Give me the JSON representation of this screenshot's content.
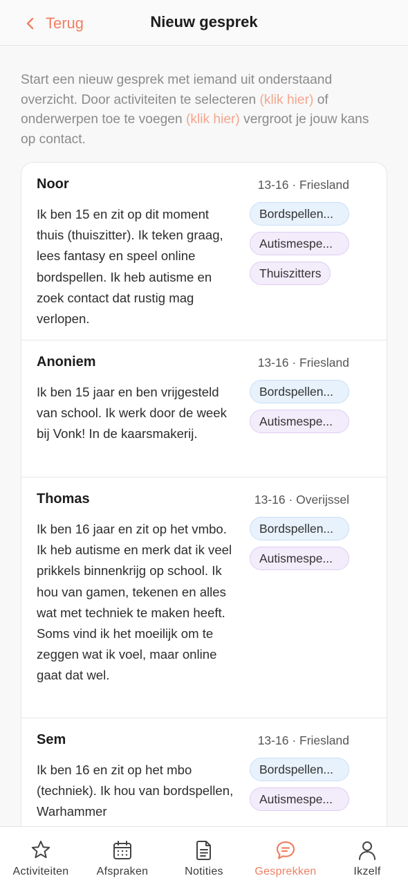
{
  "header": {
    "back_label": "Terug",
    "title": "Nieuw gesprek"
  },
  "intro": {
    "part1": "Start een nieuw gesprek met iemand uit onderstaand overzicht. Door activiteiten te selecteren ",
    "link1": "(klik hier)",
    "part2": " of onderwerpen toe te voegen ",
    "link2": "(klik hier)",
    "part3": " vergroot je jouw kans op contact."
  },
  "profiles": [
    {
      "name": "Noor",
      "meta": "13-16 · Friesland",
      "description": "Ik ben 15 en zit op dit moment thuis (thuiszitter). Ik teken graag, lees fantasy en speel online bordspellen. Ik heb autisme en zoek contact dat rustig mag verlopen.",
      "tags": [
        "Bordspellen...",
        "Autismespe...",
        "Thuiszitters"
      ]
    },
    {
      "name": "Anoniem",
      "meta": "13-16 · Friesland",
      "description": "Ik ben 15 jaar en ben vrijgesteld van school. Ik werk door de week bij Vonk! In de kaarsmakerij.",
      "tags": [
        "Bordspellen...",
        "Autismespe..."
      ]
    },
    {
      "name": "Thomas",
      "meta": "13-16 · Overijssel",
      "description": "Ik ben 16 jaar en zit op het vmbo. Ik heb autisme en merk dat ik veel prikkels binnenkrijg op school. Ik hou van gamen, tekenen en alles wat met techniek te maken heeft. Soms vind ik het moeilijk om te zeggen wat ik voel, maar online gaat dat wel.",
      "tags": [
        "Bordspellen...",
        "Autismespe..."
      ]
    },
    {
      "name": "Sem",
      "meta": "13-16 · Friesland",
      "description": "Ik ben 16 en zit op het mbo (techniek). Ik hou van bordspellen, Warhammer",
      "tags": [
        "Bordspellen...",
        "Autismespe..."
      ]
    }
  ],
  "tabbar": {
    "items": [
      {
        "label": "Activiteiten",
        "icon": "star-icon",
        "active": false
      },
      {
        "label": "Afspraken",
        "icon": "calendar-icon",
        "active": false
      },
      {
        "label": "Notities",
        "icon": "document-icon",
        "active": false
      },
      {
        "label": "Gesprekken",
        "icon": "chat-bubble-icon",
        "active": true
      },
      {
        "label": "Ikzelf",
        "icon": "person-icon",
        "active": false
      }
    ]
  },
  "colors": {
    "accent": "#f07f62",
    "link": "#f4a58f",
    "tag_blue": "#e8f2fc",
    "tag_purple": "#f3ecfb"
  }
}
